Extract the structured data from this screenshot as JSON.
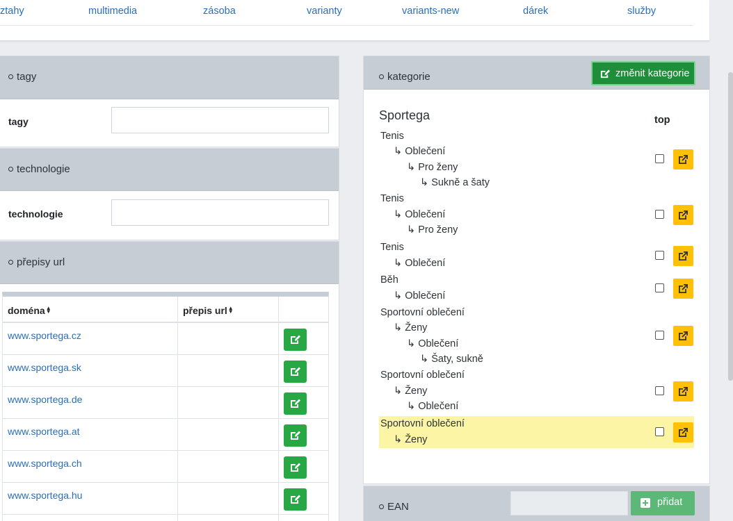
{
  "top_tabs": [
    "ztahy",
    "multimedia",
    "zásoba",
    "varianty",
    "variants-new",
    "dárek",
    "služby"
  ],
  "tags_panel": {
    "title": "tagy",
    "field_label": "tagy",
    "value": ""
  },
  "tech_panel": {
    "title": "technologie",
    "field_label": "technologie",
    "value": ""
  },
  "url_panel": {
    "title": "přepisy url",
    "columns": [
      "doména",
      "přepis url"
    ],
    "rows": [
      {
        "domain": "www.sportega.cz",
        "rewrite": ""
      },
      {
        "domain": "www.sportega.sk",
        "rewrite": ""
      },
      {
        "domain": "www.sportega.de",
        "rewrite": ""
      },
      {
        "domain": "www.sportega.at",
        "rewrite": ""
      },
      {
        "domain": "www.sportega.ch",
        "rewrite": ""
      },
      {
        "domain": "www.sportega.hu",
        "rewrite": ""
      }
    ]
  },
  "categories_panel": {
    "title": "kategorie",
    "change_button": "změnit kategorie",
    "heading": "Sportega",
    "top_label": "top",
    "groups": [
      {
        "lines": [
          "Tenis",
          "Oblečení",
          "Pro ženy",
          "Sukně a šaty"
        ],
        "highlighted": false
      },
      {
        "lines": [
          "Tenis",
          "Oblečení",
          "Pro ženy"
        ],
        "highlighted": false
      },
      {
        "lines": [
          "Tenis",
          "Oblečení"
        ],
        "highlighted": false
      },
      {
        "lines": [
          "Běh",
          "Oblečení"
        ],
        "highlighted": false
      },
      {
        "lines": [
          "Sportovní oblečení",
          "Ženy",
          "Oblečení",
          "Šaty, sukně"
        ],
        "highlighted": false
      },
      {
        "lines": [
          "Sportovní oblečení",
          "Ženy",
          "Oblečení"
        ],
        "highlighted": false
      },
      {
        "lines": [
          "Sportovní oblečení",
          "Ženy"
        ],
        "highlighted": true
      }
    ]
  },
  "ean_panel": {
    "title": "EAN",
    "input_value": "",
    "add_button": "přidat"
  },
  "colors": {
    "link": "#2a6ebb",
    "panel_header": "#c7cdd4",
    "green": "#28a745",
    "yellow": "#ffc107",
    "highlight": "#fdf5a6"
  }
}
